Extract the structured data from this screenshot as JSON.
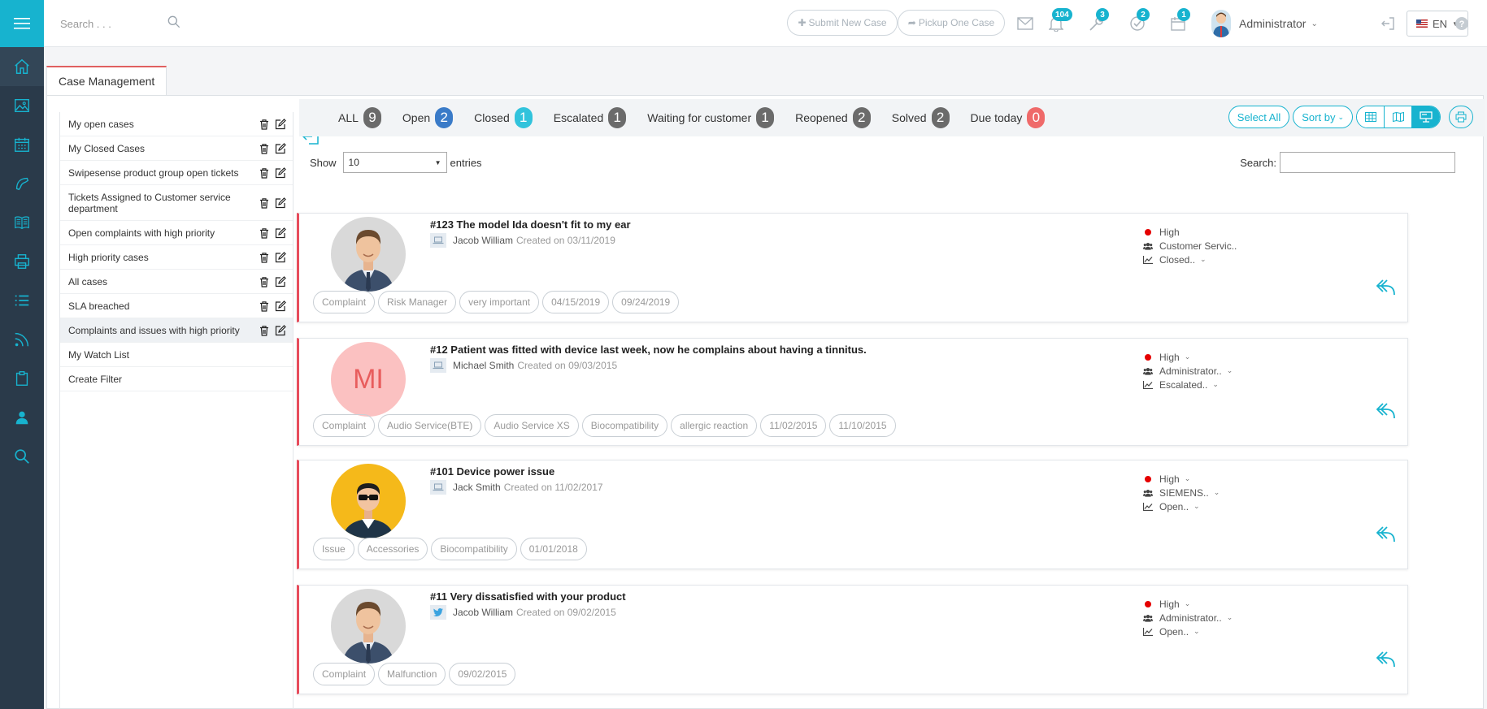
{
  "colors": {
    "accent": "#17b3cf",
    "rail": "#2a3a4a",
    "priority_high": "#e50000",
    "card_border": "#e74c5c"
  },
  "topbar": {
    "search_placeholder": "Search . . .",
    "submit_label": "Submit New Case",
    "pickup_label": "Pickup One Case",
    "badges": {
      "notifications": "104",
      "tools": "3",
      "checks": "2",
      "calendar": "1"
    },
    "user_name": "Administrator",
    "language": "EN"
  },
  "tab": {
    "label": "Case Management"
  },
  "filters": [
    {
      "label": "My open cases",
      "actions": true
    },
    {
      "label": "My Closed Cases",
      "actions": true
    },
    {
      "label": "Swipesense product group open tickets",
      "actions": true
    },
    {
      "label": "Tickets Assigned to Customer service department",
      "actions": true
    },
    {
      "label": "Open complaints with high priority",
      "actions": true
    },
    {
      "label": "High priority cases",
      "actions": true
    },
    {
      "label": "All cases",
      "actions": true
    },
    {
      "label": "SLA breached",
      "actions": true
    },
    {
      "label": "Complaints and issues with high priority",
      "actions": true,
      "active": true
    },
    {
      "label": "My Watch List",
      "actions": false
    },
    {
      "label": "Create Filter",
      "actions": false
    }
  ],
  "status": [
    {
      "label": "ALL",
      "count": "9",
      "color": "#6b6b6b"
    },
    {
      "label": "Open",
      "count": "2",
      "color": "#3a7bc8"
    },
    {
      "label": "Closed",
      "count": "1",
      "color": "#31c3dc"
    },
    {
      "label": "Escalated",
      "count": "1",
      "color": "#6b6b6b"
    },
    {
      "label": "Waiting for customer",
      "count": "1",
      "color": "#6b6b6b"
    },
    {
      "label": "Reopened",
      "count": "2",
      "color": "#6b6b6b"
    },
    {
      "label": "Solved",
      "count": "2",
      "color": "#6b6b6b"
    },
    {
      "label": "Due today",
      "count": "0",
      "color": "#ef6a6a"
    }
  ],
  "toolbar": {
    "select_all": "Select All",
    "sort_by": "Sort by"
  },
  "table": {
    "show_label": "Show",
    "page_size": "10",
    "entries_label": "entries",
    "search_label": "Search:"
  },
  "cases": [
    {
      "title": "#123 The model Ida doesn't fit to my ear",
      "author": "Jacob William",
      "created": "Created on 03/11/2019",
      "source": "web",
      "avatar": "man",
      "initials": "",
      "tags": [
        "Complaint",
        "Risk Manager",
        "very important",
        "04/15/2019",
        "09/24/2019"
      ],
      "priority": "High",
      "priority_caret": false,
      "group": "Customer Servic..",
      "group_caret": false,
      "state": "Closed..",
      "state_caret": true
    },
    {
      "title": "#12 Patient was fitted with device last week, now he complains about having a tinnitus.",
      "author": "Michael Smith",
      "created": "Created on 09/03/2015",
      "source": "web",
      "avatar": "initials",
      "initials": "MI",
      "tags": [
        "Complaint",
        "Audio Service(BTE)",
        "Audio Service XS",
        "Biocompatibility",
        "allergic reaction",
        "11/02/2015",
        "11/10/2015"
      ],
      "priority": "High",
      "priority_caret": true,
      "group": "Administrator..",
      "group_caret": true,
      "state": "Escalated..",
      "state_caret": true
    },
    {
      "title": "#101 Device power issue",
      "author": "Jack Smith",
      "created": "Created on 11/02/2017",
      "source": "web",
      "avatar": "glasses",
      "initials": "",
      "tags": [
        "Issue",
        "Accessories",
        "Biocompatibility",
        "01/01/2018"
      ],
      "priority": "High",
      "priority_caret": true,
      "group": "SIEMENS..",
      "group_caret": true,
      "state": "Open..",
      "state_caret": true
    },
    {
      "title": "#11 Very dissatisfied with your product",
      "author": "Jacob William",
      "created": "Created on 09/02/2015",
      "source": "twitter",
      "avatar": "man",
      "initials": "",
      "tags": [
        "Complaint",
        "Malfunction",
        "09/02/2015"
      ],
      "priority": "High",
      "priority_caret": true,
      "group": "Administrator..",
      "group_caret": true,
      "state": "Open..",
      "state_caret": true
    }
  ]
}
